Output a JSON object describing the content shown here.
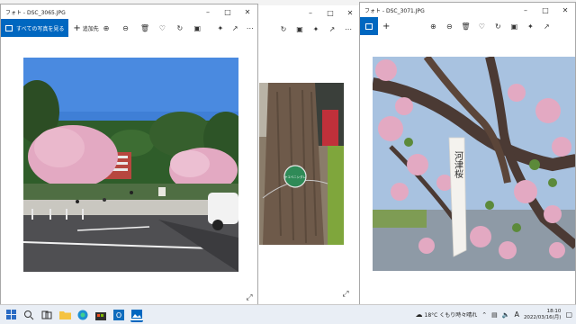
{
  "windows": {
    "left": {
      "title": "フォト - DSC_3065.JPG",
      "see_all_label": "すべての写真を見る",
      "add_label": "追加先"
    },
    "middle": {
      "title": ""
    },
    "right": {
      "title": "フォト - DSC_3071.JPG"
    }
  },
  "photo_sign": {
    "text": "ヤエベニシダレ"
  },
  "stake": {
    "text": "河津桜"
  },
  "taskbar": {
    "weather": "18°C くもり時々晴れ",
    "ime": "A",
    "time": "18:10",
    "date": "2022/03/16(月)"
  },
  "colors": {
    "accent": "#0067c0",
    "sky": "#3f7fd6",
    "blossom": "#e3a9c2"
  },
  "icons": {
    "toolbar": [
      "zoom-in-icon",
      "zoom-out-icon",
      "delete-icon",
      "heart-icon",
      "rotate-icon",
      "crop-icon",
      "edit-icon",
      "share-icon",
      "more-icon"
    ],
    "taskbar": [
      "start-icon",
      "search-icon",
      "task-view-icon",
      "file-explorer-icon",
      "edge-icon",
      "store-icon",
      "outlook-icon",
      "photos-icon"
    ]
  }
}
